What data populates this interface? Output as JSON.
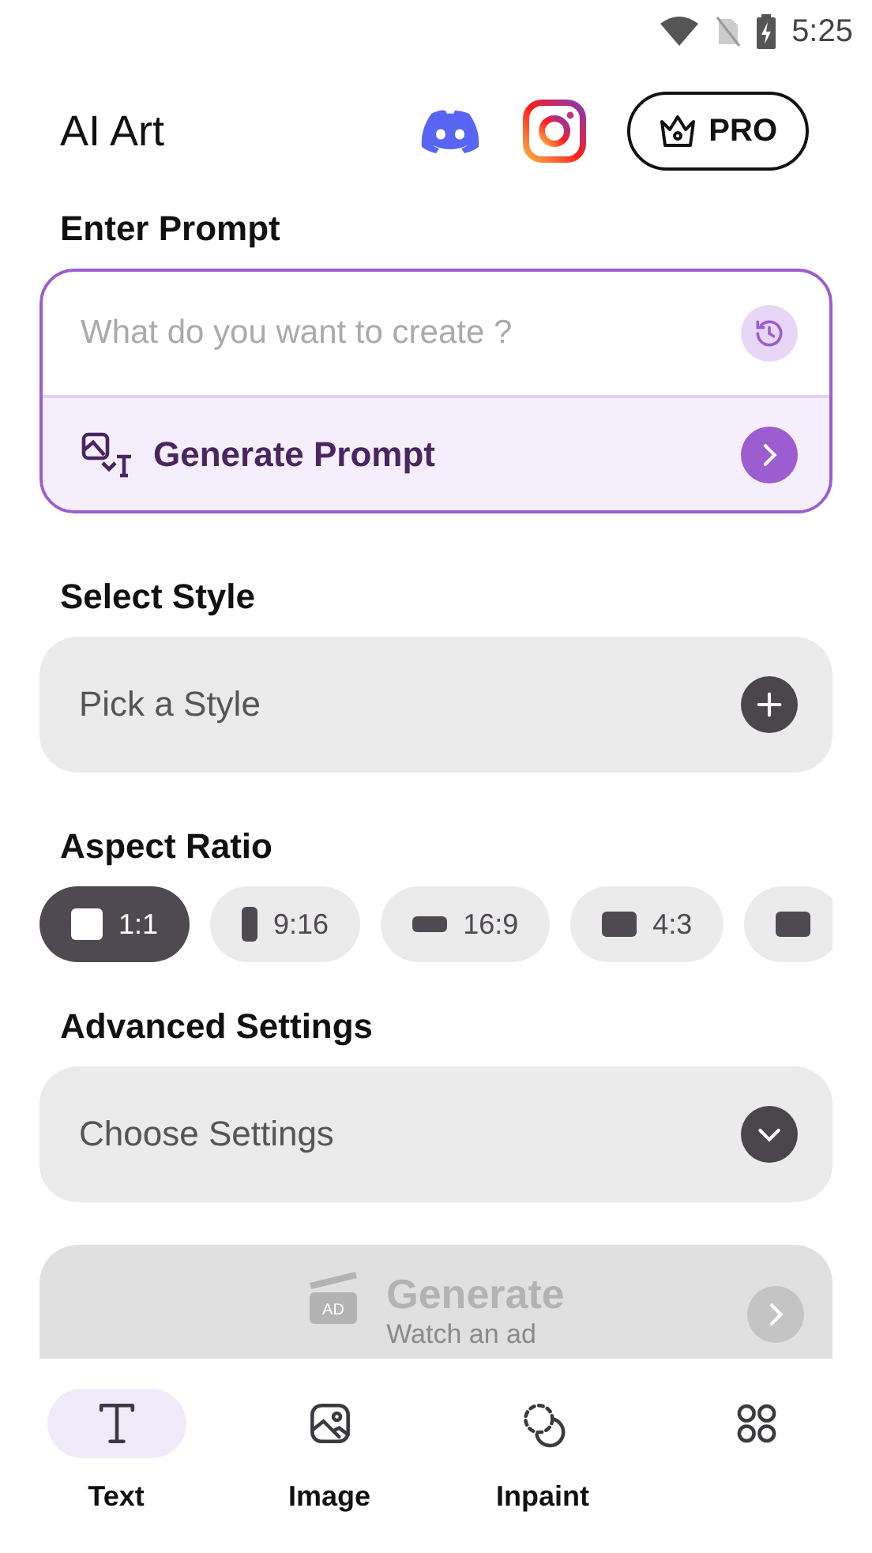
{
  "status_bar": {
    "time": "5:25"
  },
  "header": {
    "title": "AI Art",
    "pro_label": "PRO"
  },
  "prompt": {
    "heading": "Enter Prompt",
    "placeholder": "What do you want to create ?",
    "generate_label": "Generate Prompt"
  },
  "style": {
    "heading": "Select Style",
    "placeholder": "Pick a Style"
  },
  "aspect": {
    "heading": "Aspect Ratio",
    "options": [
      {
        "label": "1:1",
        "kind": "square",
        "selected": true
      },
      {
        "label": "9:16",
        "kind": "tall",
        "selected": false
      },
      {
        "label": "16:9",
        "kind": "wide",
        "selected": false
      },
      {
        "label": "4:3",
        "kind": "landscape",
        "selected": false
      },
      {
        "kind": "landscape",
        "selected": false
      }
    ]
  },
  "advanced": {
    "heading": "Advanced Settings",
    "placeholder": "Choose Settings"
  },
  "generate": {
    "label": "Generate",
    "sublabel": "Watch an ad",
    "badge": "AD",
    "disabled": true
  },
  "nav": [
    {
      "label": "Text",
      "kind": "text",
      "selected": true
    },
    {
      "label": "Image",
      "kind": "image",
      "selected": false
    },
    {
      "label": "Inpaint",
      "kind": "inpaint",
      "selected": false
    },
    {
      "kind": "grid",
      "selected": false
    }
  ]
}
